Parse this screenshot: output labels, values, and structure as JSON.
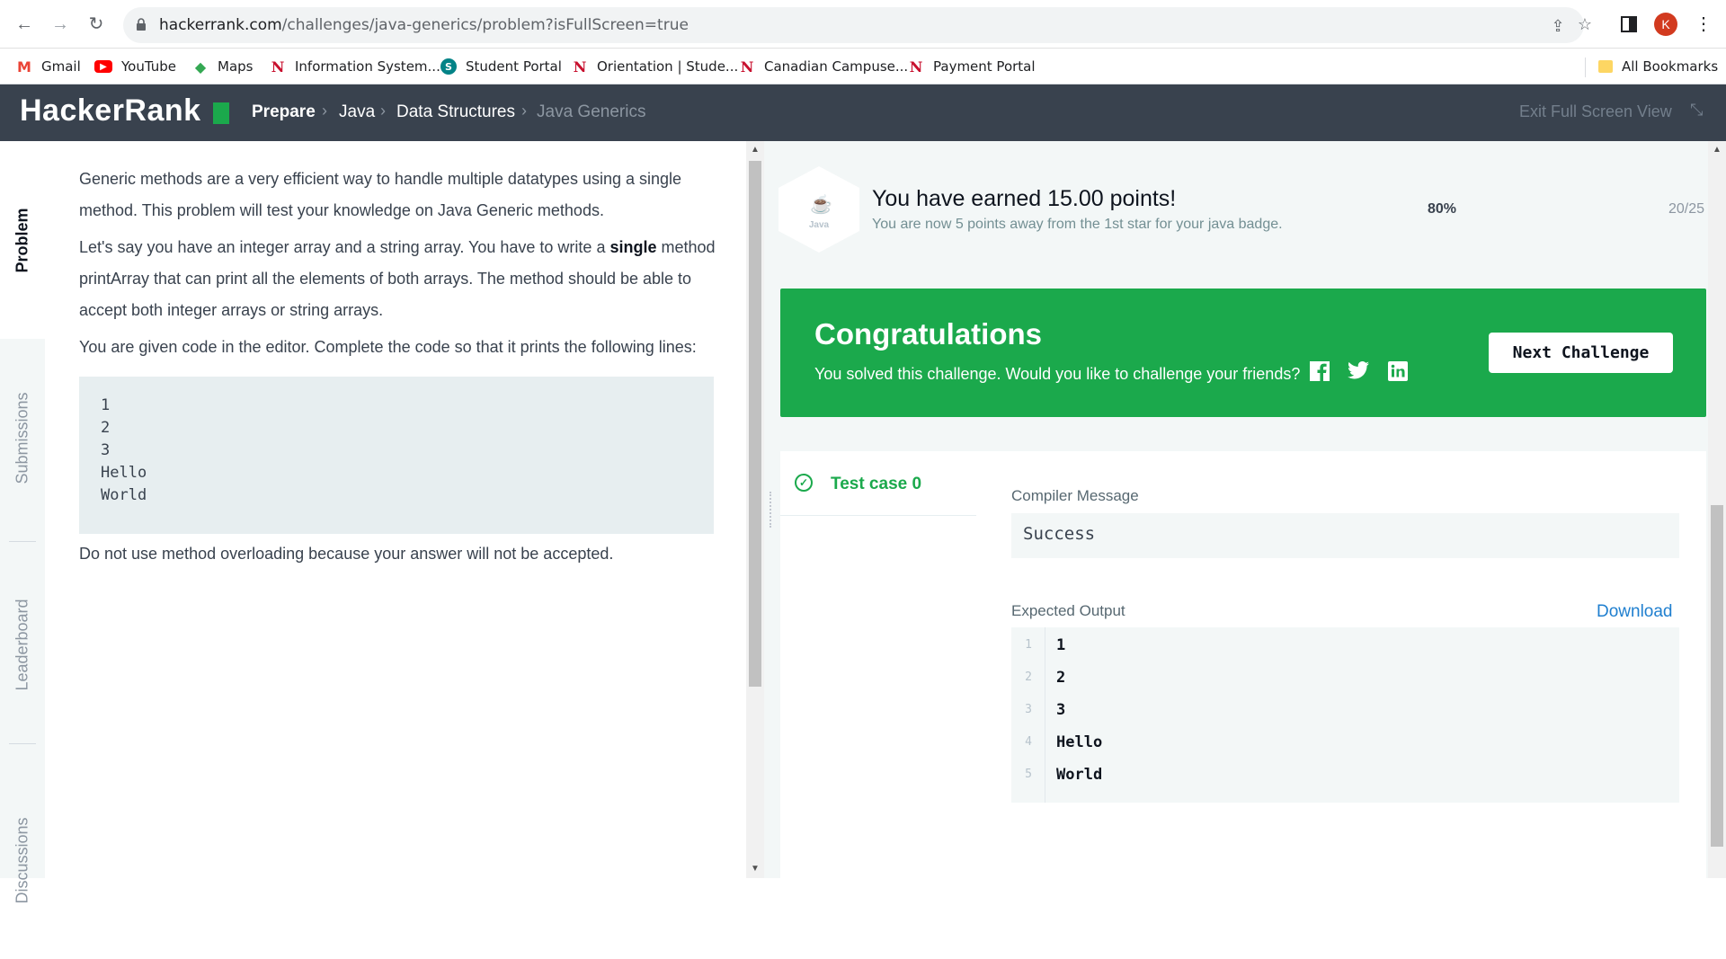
{
  "browser": {
    "url_domain": "hackerrank.com",
    "url_path": "/challenges/java-generics/problem?isFullScreen=true",
    "profile_initial": "K",
    "bookmarks": [
      {
        "label": "Gmail",
        "icon": "gmail-icon",
        "color": "#ea4335",
        "glyph": "M"
      },
      {
        "label": "YouTube",
        "icon": "youtube-icon",
        "color": "#ff0000",
        "glyph": "▶"
      },
      {
        "label": "Maps",
        "icon": "maps-icon",
        "color": "#34a853",
        "glyph": "◆"
      },
      {
        "label": "Information System...",
        "icon": "n-logo-icon",
        "color": "#c8102e",
        "glyph": "N"
      },
      {
        "label": "Student Portal",
        "icon": "sharepoint-icon",
        "color": "#038387",
        "glyph": "S"
      },
      {
        "label": "Orientation | Stude...",
        "icon": "n-logo-icon",
        "color": "#c8102e",
        "glyph": "N"
      },
      {
        "label": "Canadian Campuse...",
        "icon": "n-logo-icon",
        "color": "#c8102e",
        "glyph": "N"
      },
      {
        "label": "Payment Portal",
        "icon": "n-logo-icon",
        "color": "#c8102e",
        "glyph": "N"
      }
    ],
    "all_bookmarks": "All Bookmarks"
  },
  "header": {
    "logo": "HackerRank",
    "breadcrumbs": [
      "Prepare",
      "Java",
      "Data Structures",
      "Java Generics"
    ],
    "exit_fullscreen": "Exit Full Screen View"
  },
  "tabs": [
    "Problem",
    "Submissions",
    "Leaderboard",
    "Discussions"
  ],
  "problem": {
    "p1": "Generic methods are a very efficient way to handle multiple datatypes using a single method. This problem will test your knowledge on Java Generic methods.",
    "p2_a": "Let's say you have an integer array and a string array. You have to write a ",
    "p2_bold": "single",
    "p2_b": " method printArray that can print all the elements of both arrays. The method should be able to accept both integer arrays or string arrays.",
    "p3": "You are given code in the editor. Complete the code so that it prints the following lines:",
    "code_lines": [
      "1",
      "2",
      "3",
      "Hello",
      "World"
    ],
    "p4": "Do not use method overloading because your answer will not be accepted."
  },
  "progress": {
    "badge_label": "Java",
    "title": "You have earned 15.00 points!",
    "subtitle": "You are now 5 points away from the 1st star for your java badge.",
    "percent": "80%",
    "fraction": "20/25"
  },
  "congrats": {
    "title": "Congratulations",
    "subtitle": "You solved this challenge. Would you like to challenge your friends?",
    "next_button": "Next Challenge"
  },
  "results": {
    "test_case": "Test case 0",
    "compiler_label": "Compiler Message",
    "compiler_message": "Success",
    "expected_label": "Expected Output",
    "download": "Download",
    "output_lines": [
      {
        "n": "1",
        "t": "1"
      },
      {
        "n": "2",
        "t": "2"
      },
      {
        "n": "3",
        "t": "3"
      },
      {
        "n": "4",
        "t": "Hello"
      },
      {
        "n": "5",
        "t": "World"
      }
    ]
  },
  "colors": {
    "header_bg": "#39424e",
    "brand_green": "#1ba94c",
    "link_blue": "#1f7fcf"
  }
}
